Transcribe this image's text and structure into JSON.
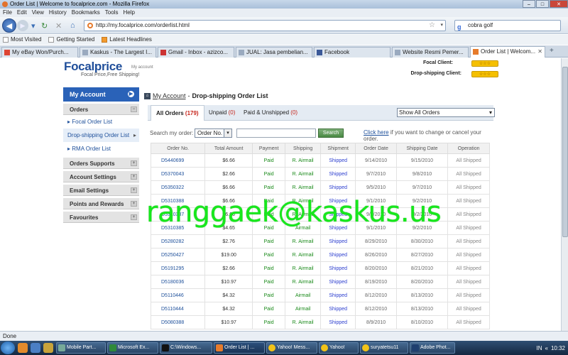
{
  "window": {
    "title": "Order List | Welcome to focalprice.com - Mozilla Firefox"
  },
  "menu": [
    "File",
    "Edit",
    "View",
    "History",
    "Bookmarks",
    "Tools",
    "Help"
  ],
  "nav": {
    "url": "http://my.focalprice.com/orderlist.html",
    "search_value": "cobra golf"
  },
  "bookmarks": [
    "Most Visited",
    "Getting Started",
    "Latest Headlines"
  ],
  "tabs": [
    {
      "label": "My eBay Won/Purch..."
    },
    {
      "label": "Kaskus - The Largest I..."
    },
    {
      "label": "Gmail - Inbox - azizco..."
    },
    {
      "label": "JUAL: Jasa pembelian..."
    },
    {
      "label": "Facebook"
    },
    {
      "label": "Website Resmi Pemer..."
    },
    {
      "label": "Order List | Welcom..."
    }
  ],
  "header": {
    "logo": "Focalprice",
    "logo_sub": "Focal Price,Free Shipping!",
    "logo_account": "My account",
    "focal_client": "Focal Client:",
    "dropship_client": "Drop-shipping Client:"
  },
  "sidebar": {
    "title": "My Account",
    "orders": "Orders",
    "links": [
      "Focal Order List",
      "Drop-shipping Order List",
      "RMA Order List"
    ],
    "sections": [
      "Orders Supports",
      "Account Settings",
      "Email Settings",
      "Points and Rewards",
      "Favourites"
    ]
  },
  "breadcrumb": {
    "link": "My Account",
    "current": "Drop-shipping Order List"
  },
  "order_tabs": [
    {
      "label": "All Orders",
      "count": "(179)"
    },
    {
      "label": "Unpaid",
      "count": "(0)"
    },
    {
      "label": "Paid & Unshipped",
      "count": "(0)"
    }
  ],
  "show_select": "Show All Orders",
  "search": {
    "label": "Search my order:",
    "field": "Order No.",
    "button": "Search",
    "link": "Click here",
    "note": "if you want to change or cancel your order."
  },
  "table": {
    "headers": [
      "Order No.",
      "Total Amount",
      "Payment",
      "Shipping",
      "Shipment",
      "Order Date",
      "Shipping Date",
      "Operation"
    ],
    "rows": [
      [
        "D5440699",
        "$6.66",
        "Paid",
        "R. Airmail",
        "Shipped",
        "9/14/2010",
        "9/15/2010",
        "All Shipped"
      ],
      [
        "D5370043",
        "$2.66",
        "Paid",
        "R. Airmail",
        "Shipped",
        "9/7/2010",
        "9/8/2010",
        "All Shipped"
      ],
      [
        "D5350322",
        "$6.66",
        "Paid",
        "R. Airmail",
        "Shipped",
        "9/5/2010",
        "9/7/2010",
        "All Shipped"
      ],
      [
        "D5310388",
        "$6.66",
        "Paid",
        "R. Airmail",
        "Shipped",
        "9/1/2010",
        "9/2/2010",
        "All Shipped"
      ],
      [
        "D5310387",
        "$6.66",
        "Paid",
        "R. Airmail",
        "Shipped",
        "9/1/2010",
        "9/2/2010",
        "All Shipped"
      ],
      [
        "D5310385",
        "$4.65",
        "Paid",
        "Airmail",
        "Shipped",
        "9/1/2010",
        "9/2/2010",
        "All Shipped"
      ],
      [
        "D5280282",
        "$2.76",
        "Paid",
        "R. Airmail",
        "Shipped",
        "8/29/2010",
        "8/30/2010",
        "All Shipped"
      ],
      [
        "D5250427",
        "$19.00",
        "Paid",
        "R. Airmail",
        "Shipped",
        "8/26/2010",
        "8/27/2010",
        "All Shipped"
      ],
      [
        "D5191295",
        "$2.66",
        "Paid",
        "R. Airmail",
        "Shipped",
        "8/20/2010",
        "8/21/2010",
        "All Shipped"
      ],
      [
        "D5180036",
        "$10.97",
        "Paid",
        "R. Airmail",
        "Shipped",
        "8/19/2010",
        "8/20/2010",
        "All Shipped"
      ],
      [
        "D5110446",
        "$4.32",
        "Paid",
        "Airmail",
        "Shipped",
        "8/12/2010",
        "8/13/2010",
        "All Shipped"
      ],
      [
        "D5110444",
        "$4.32",
        "Paid",
        "Airmail",
        "Shipped",
        "8/12/2010",
        "8/13/2010",
        "All Shipped"
      ],
      [
        "D5080388",
        "$10.97",
        "Paid",
        "R. Airmail",
        "Shipped",
        "8/9/2010",
        "8/10/2010",
        "All Shipped"
      ]
    ]
  },
  "watermark": "ranggaek@kaskus.us",
  "status": "Done",
  "taskbar": {
    "items": [
      "Mobile Part...",
      "Microsoft Ex...",
      "C:\\Windows...",
      "Order List | ...",
      "Yahoo! Mess...",
      "Yahoo!",
      "suryatetsu11",
      "Adobe Phot..."
    ],
    "lang": "IN",
    "clock": "10:32"
  },
  "colors": {
    "accent": "#2a62b8",
    "link": "#1d4f9a",
    "paid": "#1a8a1a",
    "watermark": "#17e81c"
  }
}
